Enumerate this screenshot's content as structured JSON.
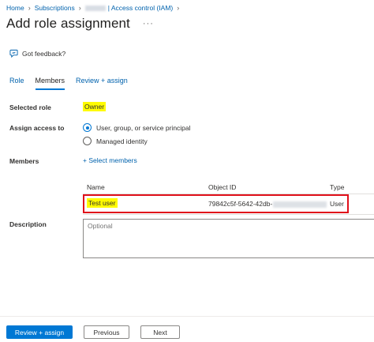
{
  "breadcrumb": {
    "home": "Home",
    "subscriptions": "Subscriptions",
    "access_control": "| Access control (IAM)"
  },
  "header": {
    "title": "Add role assignment",
    "more_label": "···"
  },
  "feedback": {
    "label": "Got feedback?"
  },
  "tabs": [
    {
      "label": "Role"
    },
    {
      "label": "Members"
    },
    {
      "label": "Review + assign"
    }
  ],
  "form": {
    "selected_role_label": "Selected role",
    "selected_role_value": "Owner",
    "assign_access_label": "Assign access to",
    "assign_options": [
      {
        "label": "User, group, or service principal",
        "checked": true
      },
      {
        "label": "Managed identity",
        "checked": false
      }
    ],
    "members_label": "Members",
    "select_members_link": "+ Select members",
    "description_label": "Description",
    "description_placeholder": "Optional"
  },
  "members_table": {
    "columns": [
      "Name",
      "Object ID",
      "Type"
    ],
    "rows": [
      {
        "name": "Test user",
        "object_id": "79842c5f-5642-42db-",
        "type": "User"
      }
    ]
  },
  "footer": {
    "review_assign": "Review + assign",
    "previous": "Previous",
    "next": "Next"
  },
  "colors": {
    "accent": "#0078d4",
    "link": "#0062ad",
    "highlight": "#fffb00",
    "annotation_border": "#e0101a"
  }
}
